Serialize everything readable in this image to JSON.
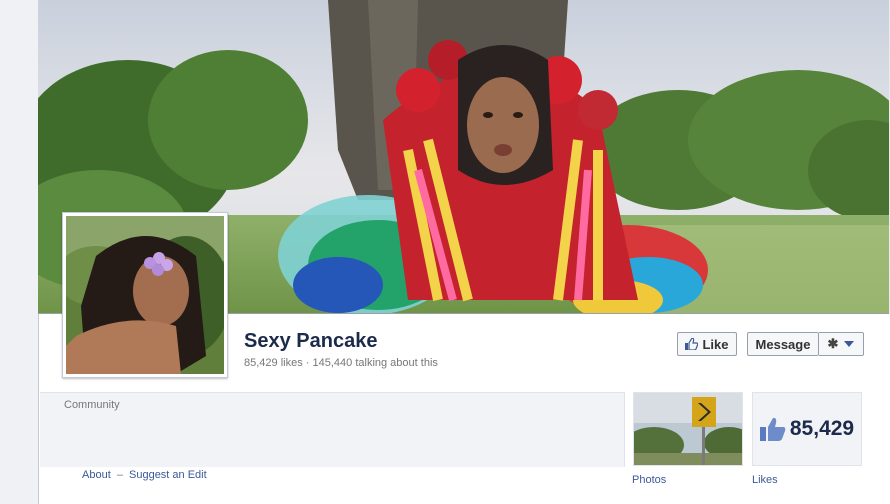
{
  "page": {
    "name": "Sexy Pancake",
    "likes_text": "85,429 likes",
    "separator": "·",
    "talking_text": "145,440 talking about this",
    "category": "Community"
  },
  "actions": {
    "like_label": "Like",
    "message_label": "Message",
    "gear_icon": "gear-icon",
    "dropdown_icon": "chevron-down-icon"
  },
  "about": {
    "about_label": "About",
    "separator": "–",
    "suggest_label": "Suggest an Edit"
  },
  "apps": {
    "photos_label": "Photos",
    "likes_label": "Likes",
    "likes_count": "85,429"
  },
  "colors": {
    "brand": "#3b5998",
    "name_text": "#1c2b4b"
  }
}
